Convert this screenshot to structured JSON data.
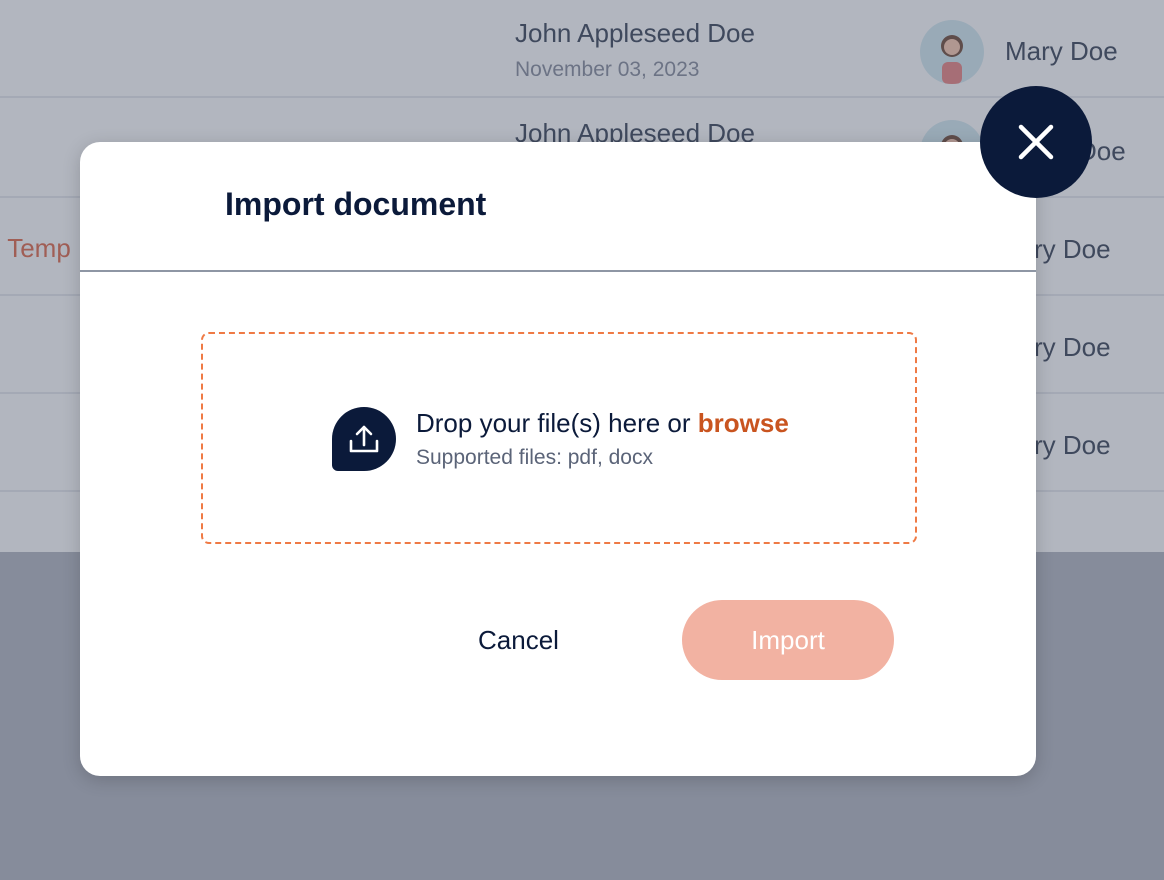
{
  "background": {
    "rows": [
      {
        "title": "John Appleseed Doe",
        "date": "November 03, 2023",
        "owner": "Mary Doe"
      },
      {
        "title": "John Appleseed Doe",
        "owner": "Doe"
      },
      {
        "template": "e Temp",
        "owner": "ry Doe"
      },
      {
        "owner": "ry Doe"
      },
      {
        "owner": "ry Doe"
      }
    ]
  },
  "modal": {
    "title": "Import document",
    "dropzone": {
      "prompt": "Drop your file(s) here or ",
      "browse_label": "browse",
      "supported": "Supported files: pdf, docx",
      "icon": "upload-icon"
    },
    "cancel_label": "Cancel",
    "import_label": "Import",
    "close_icon": "close-icon"
  },
  "colors": {
    "navy": "#0b1a3a",
    "accent": "#c9541f",
    "dropzone_border": "#ef7a45",
    "import_disabled": "#f2b2a2"
  }
}
